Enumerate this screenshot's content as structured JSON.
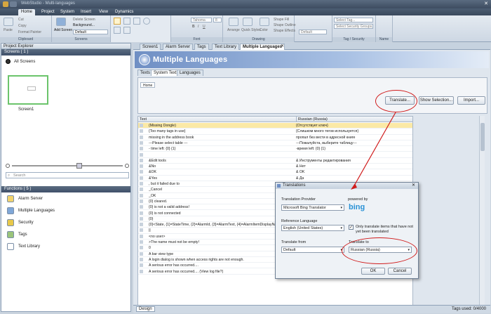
{
  "window": {
    "title": "WebStudio - Multi-languages"
  },
  "menu": {
    "tabs": [
      "Home",
      "Project",
      "System",
      "Insert",
      "View",
      "Dynamics"
    ]
  },
  "ribbon": {
    "clipboard": {
      "label": "Clipboard",
      "paste": "Paste",
      "cut": "Cut",
      "copy": "Copy",
      "format_painter": "Format Painter"
    },
    "screens": {
      "label": "Screens",
      "add_screen": "Add Screen",
      "delete_screen": "Delete Screen",
      "background": "Background...",
      "default_value": "Default"
    },
    "font": {
      "label": "Font",
      "font_name": "Tahoma",
      "font_size": "8"
    },
    "drawing": {
      "label": "Drawing",
      "arrange": "Arrange",
      "quick_styles": "Quick Styles",
      "color": "Color",
      "shape_fill": "Shape Fill",
      "shape_outline": "Shape Outline",
      "shape_effects": "Shape Effects",
      "default": "Default"
    },
    "tag_security": {
      "label": "Tag / Security",
      "select_tag": "Select Tag...",
      "select_groups": "Select Security Groups..."
    },
    "name": {
      "label": "Name"
    }
  },
  "project_explorer": {
    "title": "Project Explorer",
    "screens_header": "Screens ( 1 )",
    "all_screens": "All Screens",
    "screen_name": "Screen1",
    "search_placeholder": "Search",
    "functions_header": "Functions ( 5 )",
    "functions": [
      "Alarm Server",
      "Multiple Languages",
      "Security",
      "Tags",
      "Text Library"
    ]
  },
  "doc_tabs": [
    "Screen1",
    "Alarm Server",
    "Tags",
    "Text Library",
    "Multiple Languages"
  ],
  "banner": {
    "title": "Multiple Languages"
  },
  "sub_tabs": [
    "Texts",
    "System Texts",
    "Languages"
  ],
  "home_tab": "Home",
  "buttons": {
    "translate": "Translate...",
    "show_selection": "Show Selection...",
    "import": "Import..."
  },
  "grid": {
    "col_text": "Text",
    "col_russian": "Russian (Russia)",
    "rows": [
      [
        "(Missing Dongle)",
        "{Отсутствует ключ}"
      ],
      [
        "{Too many tags in use}",
        "{Слишком много тегов используется}"
      ],
      [
        " missing in the address book",
        "пропал без вести в адресной книге"
      ],
      [
        "---Please select table ---",
        "---Пожалуйста, выберите таблицу---"
      ],
      [
        " - time left: {0} {1}",
        "-время left: {0} {1}"
      ],
      [
        "",
        ""
      ],
      [
        "&Edit tools",
        "& Инструменты редактирования"
      ],
      [
        "&No",
        "& Нет"
      ],
      [
        "&OK",
        "& OK"
      ],
      [
        "&Yes",
        "& Да"
      ],
      [
        ", but it failed due to",
        ""
      ],
      [
        "_Cancel",
        ""
      ],
      [
        "_OK",
        ""
      ],
      [
        "{0} cleared.",
        ""
      ],
      [
        "{0} is not a valid address!",
        ""
      ],
      [
        "{0} is not connected",
        ""
      ],
      [
        "{0}",
        ""
      ],
      [
        "{0}<State, {1}=StateTime, {2}=AlarmId, {3}=AlarmText, {4}=AlarmItemDisplayNa",
        ""
      ],
      [
        "||",
        ""
      ],
      [
        "<no user>",
        ""
      ],
      [
        ">The name must not be empty!",
        ""
      ],
      [
        "0",
        ""
      ],
      [
        "A bar view type",
        ""
      ],
      [
        "A login dialog is shown when access rights are not enough.",
        ""
      ],
      [
        "A serious error has occurred....",
        "Произошла серьезная ошибка...."
      ],
      [
        "A serious error has occurred.... (View log file?)",
        "Произошла серьезная ошибка.... (Просмотр файла журнала?)"
      ]
    ]
  },
  "status": {
    "design": "Design",
    "tags_used": "Tags used: 0/4000"
  },
  "dialog": {
    "title": "Translations",
    "provider_label": "Translation Provider",
    "provider_value": "Microsoft Bing Translator",
    "powered_by": "powered by",
    "bing": "bing",
    "ref_label": "Reference Language",
    "ref_value": "English (United States)",
    "only_label": "Only translate items that have not yet been translated",
    "from_label": "Translate from",
    "from_value": "Default",
    "to_label": "Translate to",
    "to_value": "Russian (Russia)",
    "ok": "OK",
    "cancel": "Cancel"
  },
  "colors": {
    "accent": "#d01c1c",
    "selected_row": "#fbe9a6"
  }
}
